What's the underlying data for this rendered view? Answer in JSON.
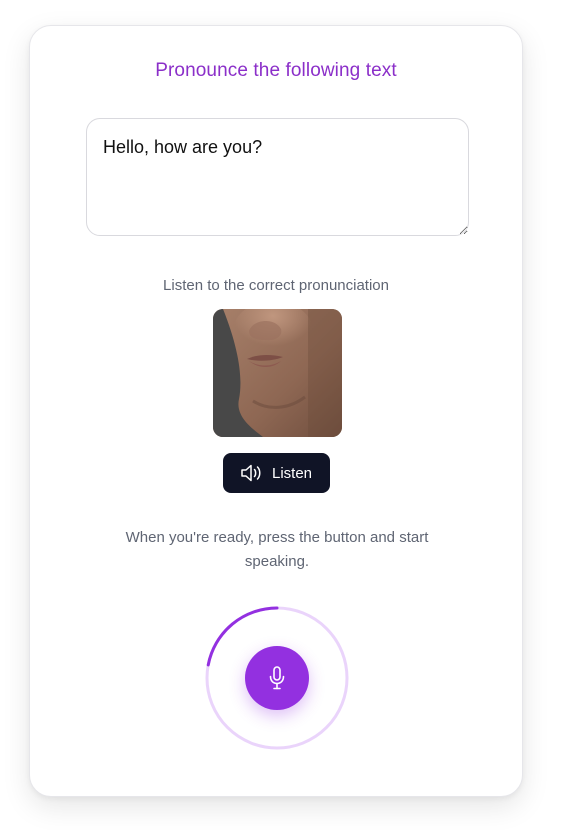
{
  "title": "Pronounce the following text",
  "text_input": {
    "value": "Hello, how are you?"
  },
  "listen_section": {
    "caption": "Listen to the correct pronunciation",
    "button_label": "Listen",
    "button_icon": "speaker-icon"
  },
  "instructions": "When you're ready, press the button and start speaking.",
  "mic": {
    "icon": "microphone-icon",
    "progress": 0.22
  },
  "colors": {
    "accent": "#9330e0",
    "title": "#8b2fc9",
    "ring_light": "#ead4fb",
    "button_dark": "#101426",
    "muted_text": "#5f6573"
  }
}
